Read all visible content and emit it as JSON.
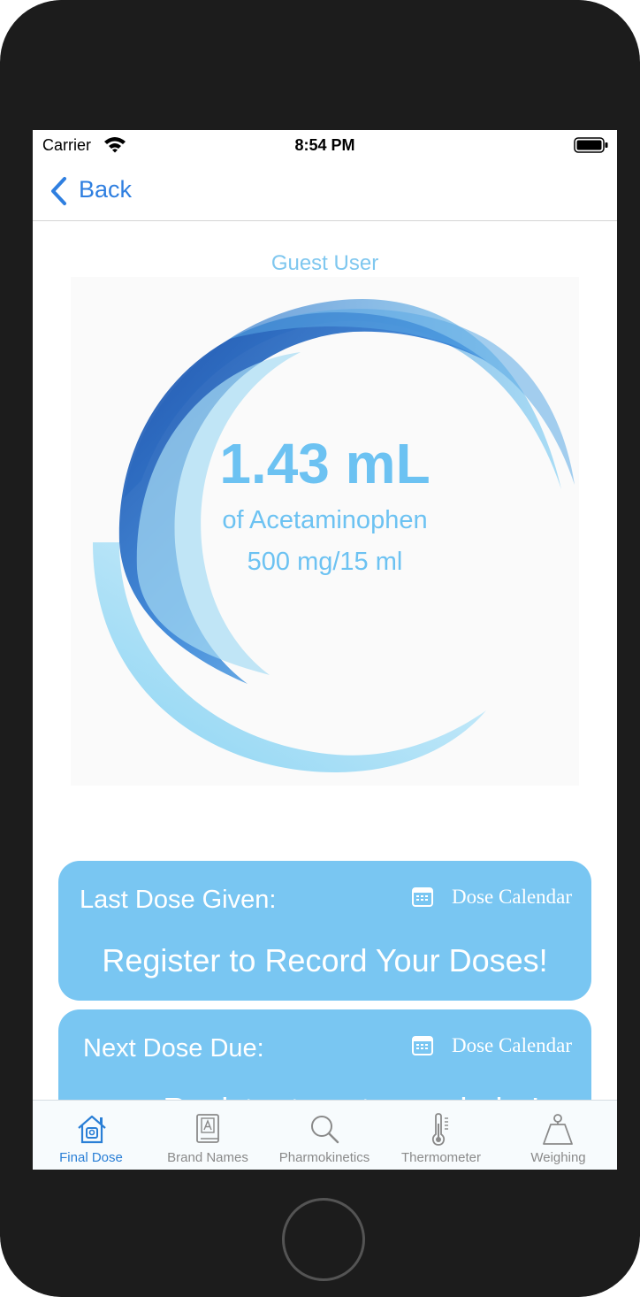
{
  "status_bar": {
    "carrier": "Carrier",
    "time": "8:54 PM"
  },
  "nav": {
    "back_label": "Back"
  },
  "user": {
    "name": "Guest User"
  },
  "dose": {
    "amount": "1.43 mL",
    "drug": "of Acetaminophen",
    "concentration": "500 mg/15 ml"
  },
  "cards": {
    "last_dose": {
      "title": "Last Dose Given:",
      "calendar_label": "Dose Calendar",
      "message": "Register to Record Your Doses!"
    },
    "next_dose": {
      "title": "Next Dose Due:",
      "calendar_label": "Dose Calendar",
      "message": "Register to get a reminder!"
    }
  },
  "tabs": [
    {
      "label": "Final Dose",
      "icon": "home-icon",
      "active": true
    },
    {
      "label": "Brand Names",
      "icon": "book-icon",
      "active": false
    },
    {
      "label": "Pharmokinetics",
      "icon": "search-icon",
      "active": false
    },
    {
      "label": "Thermometer",
      "icon": "thermometer-icon",
      "active": false
    },
    {
      "label": "Weighing",
      "icon": "scale-icon",
      "active": false
    }
  ],
  "colors": {
    "accent_blue": "#2f7fe0",
    "card_blue": "#79c6f2",
    "dose_text": "#6cc2f2",
    "tab_active": "#2a7fd6",
    "tab_inactive": "#8a8a8a"
  }
}
